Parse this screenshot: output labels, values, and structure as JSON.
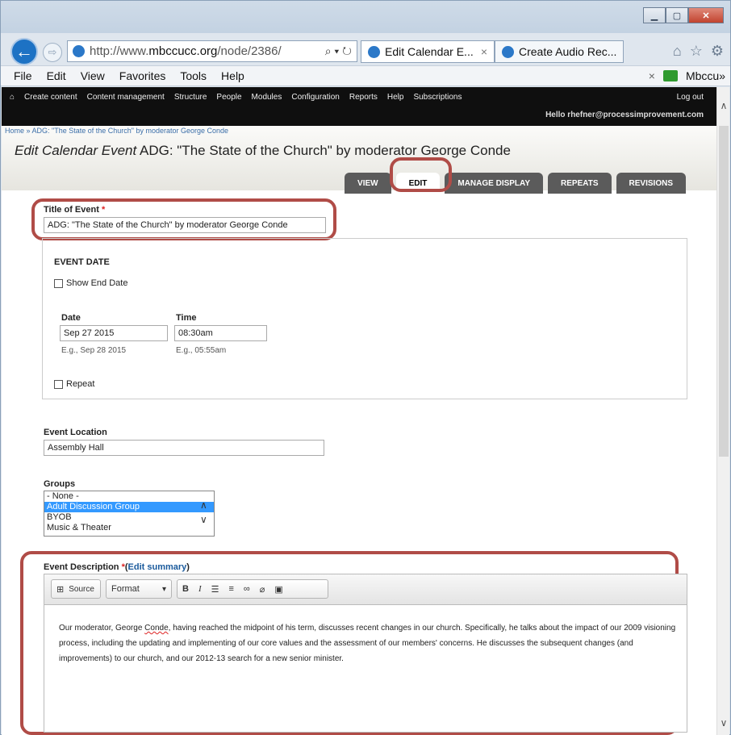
{
  "browser": {
    "url_prefix": "http://www.",
    "url_domain": "mbccucc.org",
    "url_suffix": "/node/2386/",
    "addr_tools": "⌕ ▾ ↻",
    "tabs": [
      {
        "label": "Edit Calendar E...",
        "close": "×"
      },
      {
        "label": "Create Audio Rec..."
      }
    ],
    "menu": [
      "File",
      "Edit",
      "View",
      "Favorites",
      "Tools",
      "Help"
    ],
    "menu_right_label": "Mbccu»",
    "menu_close": "×"
  },
  "admin": {
    "home": "⌂",
    "links": [
      "Create content",
      "Content management",
      "Structure",
      "People",
      "Modules",
      "Configuration",
      "Reports",
      "Help",
      "Subscriptions"
    ],
    "logout": "Log out",
    "hello": "Hello rhefner@processimprovement.com"
  },
  "page": {
    "breadcrumb": "Home » ADG: \"The State of the Church\" by moderator George Conde",
    "title_italic": "Edit Calendar Event",
    "title_rest": " ADG: \"The State of the Church\" by moderator George Conde",
    "tabs": [
      "VIEW",
      "EDIT",
      "MANAGE DISPLAY",
      "REPEATS",
      "REVISIONS"
    ],
    "active_tab": "EDIT"
  },
  "form": {
    "title_label": "Title of Event",
    "required_mark": "*",
    "title_value": "ADG: \"The State of the Church\" by moderator George Conde",
    "event_date_heading": "EVENT DATE",
    "show_end_date": "Show End Date",
    "date_label": "Date",
    "time_label": "Time",
    "date_value": "Sep 27 2015",
    "time_value": "08:30am",
    "date_hint": "E.g., Sep 28 2015",
    "time_hint": "E.g., 05:55am",
    "repeat_label": "Repeat",
    "location_label": "Event Location",
    "location_value": "Assembly Hall",
    "groups_label": "Groups",
    "groups_options": [
      "- None -",
      "Adult Discussion Group",
      "BYOB",
      "Music & Theater"
    ],
    "groups_selected": "Adult Discussion Group",
    "description_label": "Event Description",
    "edit_summary": "Edit summary",
    "editor_toolbar": {
      "source": "Source",
      "format": "Format",
      "bold": "B",
      "italic": "I"
    },
    "description_text_1": "Our moderator, George ",
    "description_name": "Conde",
    "description_text_2": ", having reached the midpoint of his term, discusses recent changes in our church.  Specifically, he talks about the impact of our 2009 visioning process, including the updating and implementing of our core values and the assessment of our members' concerns. He discusses the subsequent changes (and improvements) to our church, and our 2012-13 search for a new senior minister."
  },
  "colors": {
    "highlight": "#b04c47",
    "admin_bar": "#0f0f0f",
    "selected": "#3399ff"
  }
}
